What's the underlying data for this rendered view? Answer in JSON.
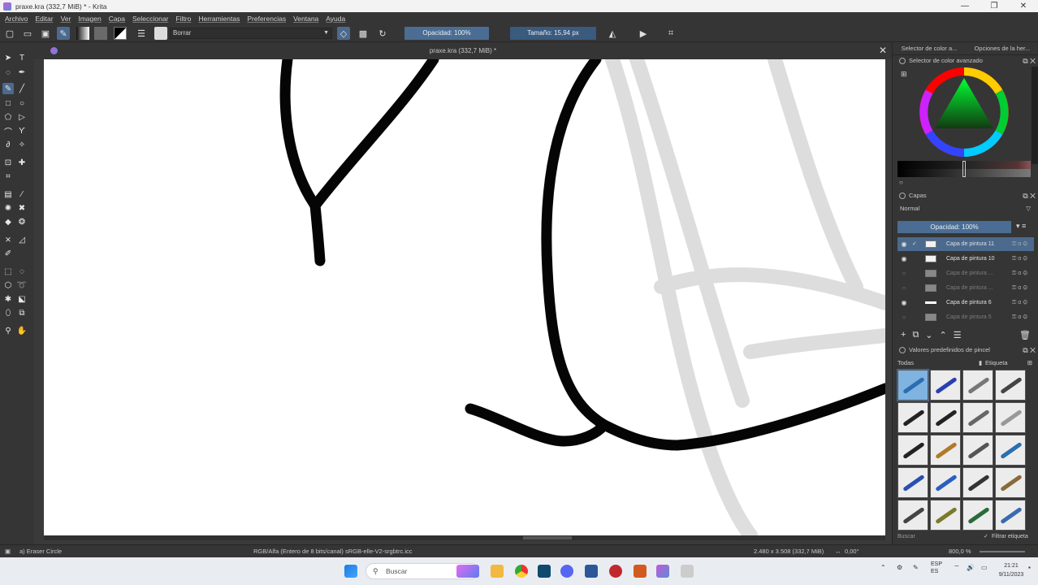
{
  "window": {
    "title": "praxe.kra (332,7 MiB) * - Krita",
    "controls": [
      "—",
      "❐",
      "✕"
    ]
  },
  "menu": [
    "Archivo",
    "Editar",
    "Ver",
    "Imagen",
    "Capa",
    "Seleccionar",
    "Filtro",
    "Herramientas",
    "Preferencias",
    "Ventana",
    "Ayuda"
  ],
  "toolbar": {
    "preset_name": "Borrar",
    "opacity_label": "Opacidad: 100%",
    "size_label": "Tamaño: 15,94 px"
  },
  "document": {
    "tab_title": "praxe.kra (332,7 MiB) *",
    "close_glyph": "✕"
  },
  "docker": {
    "tabs": [
      "Selector de color a...",
      "Opciones de la her..."
    ],
    "color_selector_title": "Selector de color avanzado",
    "layers_title": "Capas",
    "blend_mode": "Normal",
    "layer_opacity": "Opacidad: 100%",
    "layers": [
      {
        "name": "Capa de pintura 11",
        "visible": true,
        "selected": true,
        "faded": false
      },
      {
        "name": "Capa de pintura 10",
        "visible": true,
        "selected": false,
        "faded": false
      },
      {
        "name": "Capa de pintura ...",
        "visible": false,
        "selected": false,
        "faded": true
      },
      {
        "name": "Capa de pintura ...",
        "visible": false,
        "selected": false,
        "faded": true
      },
      {
        "name": "Capa de pintura 6",
        "visible": true,
        "selected": false,
        "faded": false
      },
      {
        "name": "Capa de pintura 5",
        "visible": false,
        "selected": false,
        "faded": true
      }
    ],
    "presets_title": "Valores predefinidos de pincel",
    "preset_filter": "Todas",
    "preset_tag_label": "Etiqueta",
    "preset_search_placeholder": "Buscar",
    "preset_filter_tag": "Filtrar etiqueta"
  },
  "status": {
    "tool": "a) Eraser Circle",
    "color_space": "RGB/Alfa (Entero de 8 bits/canal)  sRGB-elle-V2-srgbtrc.icc",
    "dimensions": "2.480 x 3.508 (332,7 MiB)",
    "rotation": "0,00°",
    "zoom": "800,0 %"
  },
  "taskbar": {
    "search_placeholder": "Buscar",
    "lang": "ESP",
    "lang_sub": "ES",
    "time": "21:21",
    "date": "9/11/2023"
  },
  "colors": {
    "accent": "#4b6a8e",
    "panel": "#353535",
    "canvas": "#ffffff"
  }
}
